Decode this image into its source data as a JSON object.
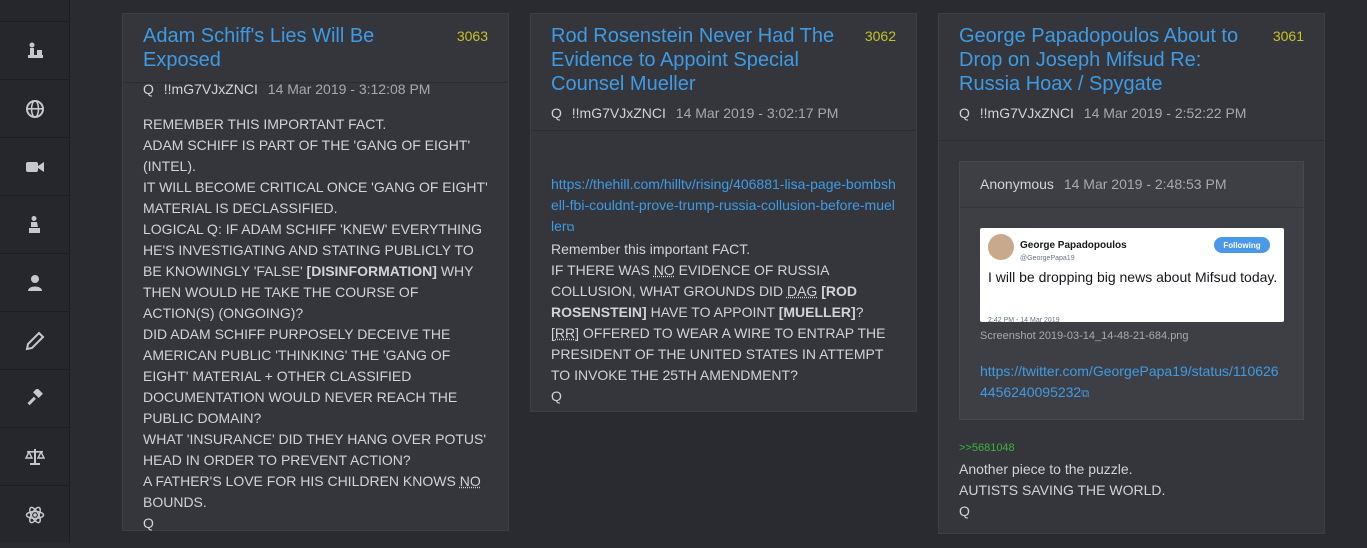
{
  "sidebar": {
    "items": [
      {
        "icon": "chess-icon"
      },
      {
        "icon": "globe-icon"
      },
      {
        "icon": "video-camera-icon"
      },
      {
        "icon": "person-podium-icon"
      },
      {
        "icon": "user-icon"
      },
      {
        "icon": "pencil-icon"
      },
      {
        "icon": "gavel-icon"
      },
      {
        "icon": "scales-icon"
      },
      {
        "icon": "atom-icon"
      }
    ]
  },
  "posts": [
    {
      "title": "Adam Schiff's Lies Will Be Exposed",
      "number": "3063",
      "author": "Q",
      "tripcode": "!!mG7VJxZNCI",
      "date": "14 Mar 2019 - 3:12:08 PM",
      "lines": [
        "REMEMBER THIS IMPORTANT FACT.",
        "ADAM SCHIFF IS PART OF THE 'GANG OF EIGHT' (INTEL).",
        "IT WILL BECOME CRITICAL ONCE 'GANG OF EIGHT' MATERIAL IS DECLASSIFIED.",
        "LOGICAL Q: IF ADAM SCHIFF 'KNEW' EVERYTHING HE'S INVESTIGATING AND STATING PUBLICLY TO BE KNOWINGLY 'FALSE'",
        "[DISINFORMATION]",
        "WHY THEN WOULD HE TAKE THE COURSE OF ACTION(S) (ONGOING)?",
        "DID ADAM SCHIFF PURPOSELY DECEIVE THE AMERICAN PUBLIC 'THINKING' THE 'GANG OF EIGHT' MATERIAL + OTHER CLASSIFIED DOCUMENTATION WOULD NEVER REACH THE PUBLIC DOMAIN?",
        "WHAT 'INSURANCE' DID THEY HANG OVER POTUS' HEAD IN ORDER TO PREVENT ACTION?",
        "A FATHER'S LOVE FOR HIS CHILDREN KNOWS",
        "NO",
        "BOUNDS.",
        "Q"
      ]
    },
    {
      "title": "Rod Rosenstein Never Had The Evidence to Appoint Special Counsel Mueller",
      "number": "3062",
      "author": "Q",
      "tripcode": "!!mG7VJxZNCI",
      "date": "14 Mar 2019 - 3:02:17 PM",
      "link": "https://thehill.com/hilltv/rising/406881-lisa-page-bombshell-fbi-couldnt-prove-trump-russia-collusion-before-mueller",
      "lines": [
        "Remember this important FACT.",
        "IF THERE WAS",
        "NO",
        "EVIDENCE OF RUSSIA COLLUSION, WHAT GROUNDS DID",
        "DAG",
        "[ROD ROSENSTEIN]",
        "HAVE TO APPOINT",
        "[MUELLER]",
        "?",
        "[RR]",
        "OFFERED TO WEAR A WIRE TO ENTRAP THE PRESIDENT OF THE UNITED STATES IN ATTEMPT TO INVOKE THE 25TH AMENDMENT?",
        "Q"
      ]
    },
    {
      "title": "George Papadopoulos About to Drop on Joseph Mifsud Re: Russia Hoax / Spygate",
      "number": "3061",
      "author": "Q",
      "tripcode": "!!mG7VJxZNCI",
      "date": "14 Mar 2019 - 2:52:22 PM",
      "quote": {
        "author": "Anonymous",
        "date": "14 Mar 2019 - 2:48:53 PM",
        "tweet": {
          "name": "George Papadopoulos",
          "handle": "@GeorgePapa19",
          "follow": "Following",
          "text": "I will be dropping big news about Mifsud today.",
          "time": "2:42 PM - 14 Mar 2019"
        },
        "filename": "Screenshot 2019-03-14_14-48-21-684.png",
        "link": "https://twitter.com/GeorgePapa19/status/1106264456240095232"
      },
      "reply_ref": ">>5681048",
      "lines": [
        "Another piece to the puzzle.",
        "AUTISTS SAVING THE WORLD.",
        "Q"
      ]
    }
  ]
}
